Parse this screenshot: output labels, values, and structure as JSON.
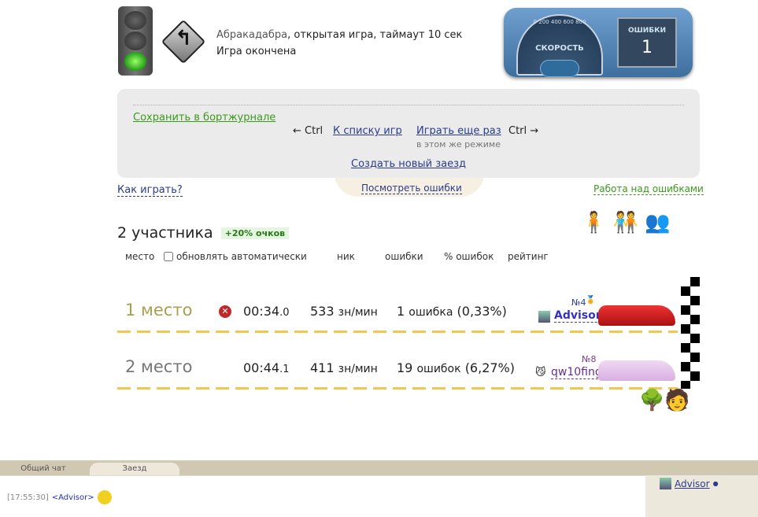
{
  "header": {
    "text_name": "Абракадабра",
    "text_rest": ", открытая игра, таймаут 10 сек",
    "status": "Игра окончена",
    "icons": [
      "traffic-light-icon",
      "winding-road-sign-icon"
    ]
  },
  "dashboard": {
    "speed_label": "СКОРОСТЬ",
    "speed_ticks": [
      "0",
      "200",
      "400",
      "600",
      "800"
    ],
    "errors_label": "ОШИБКИ",
    "errors_value": "1"
  },
  "panel": {
    "save": "Сохранить в бортжурнале",
    "ctrl_left": "← Ctrl",
    "to_list": "К списку игр",
    "play_again": "Играть еще раз",
    "ctrl_right": "Ctrl →",
    "same_mode": "в этом же режиме",
    "create": "Создать новый заезд"
  },
  "links": {
    "how": "Как играть?",
    "view_errors": "Посмотреть ошибки",
    "work_errors": "Работа над ошибками"
  },
  "participants": {
    "title": "2 участника",
    "bonus": "+20% очков",
    "columns": {
      "place": "место",
      "auto_update": "обновлять автоматически",
      "nick": "ник",
      "errors": "ошибки",
      "err_pct": "% ошибок",
      "rating": "рейтинг"
    },
    "auto_update_checked": false
  },
  "results": [
    {
      "place": "1 место",
      "time_main": "00:34",
      "time_frac": ".0",
      "speed": "533",
      "speed_unit": "зн/мин",
      "errors": "1",
      "errors_word": "ошибка",
      "pct": "(0,33%)",
      "rank": "№4",
      "nick": "Advisor",
      "car_color": "#d42020",
      "place_color": "#a8a050"
    },
    {
      "place": "2 место",
      "time_main": "00:44",
      "time_frac": ".1",
      "speed": "411",
      "speed_unit": "зн/мин",
      "errors": "19",
      "errors_word": "ошибок",
      "pct": "(6,27%)",
      "rank": "№8",
      "nick": "qw10fing",
      "car_color": "#e0b8e8",
      "place_color": "#777"
    }
  ],
  "chat": {
    "tabs": [
      "Общий чат",
      "Заезд"
    ],
    "active_tab": 1,
    "messages": [
      {
        "time": "[17:55:30]",
        "user": "<Advisor>"
      }
    ],
    "users": [
      {
        "nick": "Advisor"
      }
    ]
  }
}
